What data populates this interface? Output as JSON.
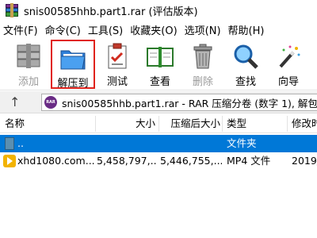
{
  "window": {
    "title": "snis00585hhb.part1.rar (评估版本)"
  },
  "menu": [
    {
      "label": "文件(F)"
    },
    {
      "label": "命令(C)"
    },
    {
      "label": "工具(S)"
    },
    {
      "label": "收藏夹(O)"
    },
    {
      "label": "选项(N)"
    },
    {
      "label": "帮助(H)"
    }
  ],
  "toolbar": {
    "add": "添加",
    "extract": "解压到",
    "test": "测试",
    "view": "查看",
    "delete": "删除",
    "find": "查找",
    "wizard": "向导"
  },
  "address": {
    "badge": "RAR",
    "path": "snis00585hhb.part1.rar - RAR 压缩分卷 (数字 1), 解包大小"
  },
  "columns": {
    "name": "名称",
    "size": "大小",
    "packed": "压缩后大小",
    "type": "类型",
    "modified": "修改时"
  },
  "rows": [
    {
      "name": "..",
      "size": "",
      "packed": "",
      "type": "文件夹",
      "modified": "",
      "selected": true
    },
    {
      "name": "xhd1080.com...",
      "size": "5,458,797,...",
      "packed": "5,446,755,...",
      "type": "MP4 文件",
      "modified": "2019/",
      "selected": false
    }
  ],
  "colors": {
    "selection": "#0078d7",
    "highlight_border": "#e0231c"
  }
}
